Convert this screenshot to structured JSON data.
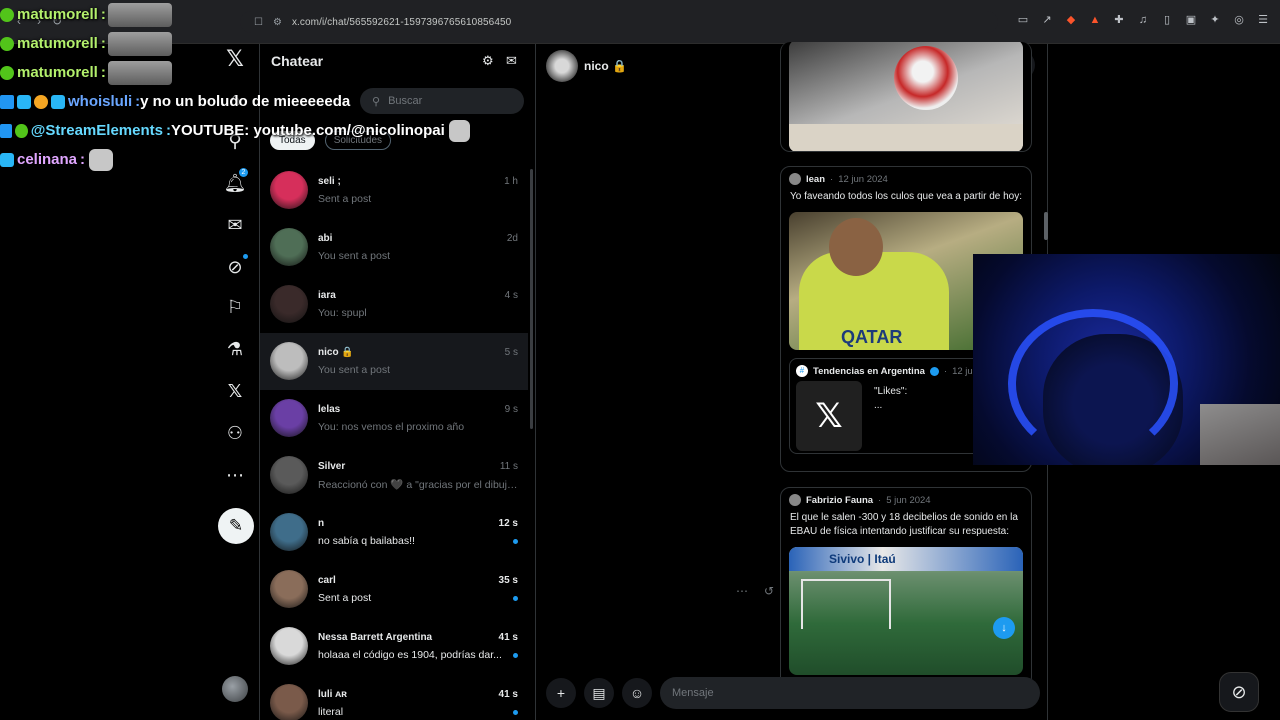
{
  "browser": {
    "url": "x.com/i/chat/565592621-1597396765610856450"
  },
  "stream_chat": [
    {
      "user": "matumorell",
      "sep": ":",
      "message": "",
      "emote": "large",
      "color": "#b3f06c",
      "badges": [
        "green"
      ]
    },
    {
      "user": "matumorell",
      "sep": ":",
      "message": "",
      "emote": "large",
      "color": "#b3f06c",
      "badges": [
        "green"
      ]
    },
    {
      "user": "matumorell",
      "sep": ":",
      "message": "",
      "emote": "large",
      "color": "#b3f06c",
      "badges": [
        "green"
      ]
    },
    {
      "user": "whoisluli",
      "sep": ":",
      "message": " y no un boludo de mieeeeeda",
      "emote": "none",
      "color": "#6aa6ff",
      "badges": [
        "blue",
        "cyan",
        "orange",
        "cyan"
      ]
    },
    {
      "user": "@StreamElements",
      "sep": ":",
      "message": " YOUTUBE: youtube.com/@nicolinopai",
      "emote": "small",
      "color": "#66d9ff",
      "badges": [
        "blue",
        "green"
      ]
    },
    {
      "user": "celinana",
      "sep": ":",
      "message": "",
      "emote": "small",
      "color": "#e0a6ff",
      "badges": [
        "cyan"
      ]
    }
  ],
  "dm_panel": {
    "title": "Chatear",
    "search_placeholder": "Buscar",
    "tabs": [
      {
        "label": "Todas",
        "active": true
      },
      {
        "label": "Solicitudes",
        "active": false
      }
    ],
    "conversations": [
      {
        "name": "seli ;",
        "preview": "Sent a post",
        "time": "1 h",
        "unread": false,
        "selected": false,
        "avatar_color": "#d62f5b"
      },
      {
        "name": "abi",
        "preview": "You sent a post",
        "time": "2d",
        "unread": false,
        "selected": false,
        "avatar_color": "#4f6e56"
      },
      {
        "name": "iara",
        "preview": "You: spupl",
        "time": "4 s",
        "unread": false,
        "selected": false,
        "avatar_color": "#3a2a2a"
      },
      {
        "name": "nico 🔒",
        "preview": "You sent a post",
        "time": "5 s",
        "unread": false,
        "selected": true,
        "avatar_color": "#bdbdbd"
      },
      {
        "name": "lelas",
        "preview": "You: nos vemos el proximo año",
        "time": "9 s",
        "unread": false,
        "selected": false,
        "avatar_color": "#6a3fa5"
      },
      {
        "name": "Silver",
        "preview": "Reaccionó con 🖤 a \"gracias por el dibujit...",
        "time": "11 s",
        "unread": false,
        "selected": false,
        "avatar_color": "#5a5a5a"
      },
      {
        "name": "n",
        "preview": "no sabía q bailabas!!",
        "time": "12 s",
        "unread": true,
        "selected": false,
        "avatar_color": "#3f6d8a"
      },
      {
        "name": "carl",
        "preview": "Sent a post",
        "time": "35 s",
        "unread": true,
        "selected": false,
        "avatar_color": "#8a6d5a"
      },
      {
        "name": "Nessa Barrett Argentina",
        "preview": "holaaa el código es 1904, podrías dar...",
        "time": "41 s",
        "unread": true,
        "selected": false,
        "avatar_color": "#d9d9d9"
      },
      {
        "name": "luli ᴀʀ",
        "preview": "literal",
        "time": "41 s",
        "unread": true,
        "selected": false,
        "avatar_color": "#7a5a4a"
      }
    ]
  },
  "conversation": {
    "name": "nico",
    "lock": "🔒",
    "composer_placeholder": "Mensaje",
    "posts": [
      {
        "author": "lean",
        "date": "12 jun 2024",
        "text": "Yo faveando todos los culos que vea a partir de hoy:",
        "quote": {
          "author": "Tendencias en Argentina",
          "date": "12 jun",
          "text_line1": "\"Likes\":",
          "text_line2": "..."
        }
      },
      {
        "author": "Fabrizio Fauna",
        "date": "5 jun 2024",
        "text": "El que le salen -300 y 18 decibelios de sonido en la EBAU de física intentando justificar su respuesta:"
      }
    ]
  },
  "icons": {
    "x_logo": "x-logo-icon",
    "home": "home-icon",
    "explore": "search-icon",
    "notifications": "bell-icon",
    "messages": "mail-icon",
    "grok": "grok-icon",
    "bookmarks": "bookmark-icon",
    "communities": "flask-icon",
    "premium": "x-premium-icon",
    "profile": "person-icon",
    "more": "more-icon",
    "compose": "feather-icon"
  },
  "accent_color": "#1d9bf0"
}
